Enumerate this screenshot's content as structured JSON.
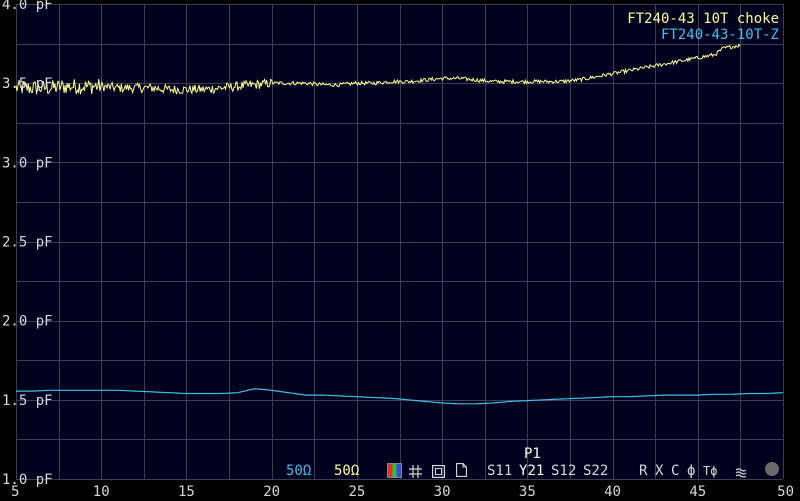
{
  "chart_data": {
    "type": "line",
    "xlim": [
      5,
      50
    ],
    "ylim": [
      1.0,
      4.0
    ],
    "x_ticks": [
      "5",
      "10",
      "15",
      "20",
      "25",
      "30",
      "35",
      "40",
      "45",
      "50"
    ],
    "y_ticks": [
      "1.0 pF",
      "1.5 pF",
      "2.0 pF",
      "2.5 pF",
      "3.0 pF",
      "3.5 pF",
      "4.0 pF"
    ],
    "grid": true,
    "legend_position": "top-right",
    "series": [
      {
        "name": "FT240-43  10T  choke",
        "color": "#ffff90",
        "noisy": true,
        "x": [
          5,
          6,
          7,
          8,
          9,
          10,
          11,
          12,
          13,
          14,
          15,
          16,
          17,
          18,
          19,
          20,
          21,
          22,
          23,
          24,
          25,
          26,
          27,
          28,
          29,
          30,
          31,
          32,
          33,
          34,
          35,
          36,
          37,
          38,
          39,
          40,
          41,
          42,
          43,
          44,
          45,
          45.5,
          46,
          46.5,
          47,
          47.5
        ],
        "y": [
          3.47,
          3.47,
          3.47,
          3.48,
          3.48,
          3.48,
          3.47,
          3.47,
          3.47,
          3.46,
          3.46,
          3.46,
          3.47,
          3.48,
          3.49,
          3.5,
          3.5,
          3.5,
          3.49,
          3.49,
          3.5,
          3.5,
          3.51,
          3.51,
          3.52,
          3.53,
          3.53,
          3.52,
          3.51,
          3.51,
          3.51,
          3.51,
          3.51,
          3.52,
          3.54,
          3.56,
          3.58,
          3.6,
          3.62,
          3.64,
          3.66,
          3.67,
          3.68,
          3.72,
          3.73,
          3.74
        ]
      },
      {
        "name": "FT240-43-10T-Z",
        "color": "#40c0e8",
        "noisy": false,
        "x": [
          5,
          6,
          7,
          8,
          9,
          10,
          11,
          12,
          13,
          14,
          15,
          16,
          17,
          18,
          19,
          20,
          21,
          22,
          23,
          24,
          25,
          26,
          27,
          28,
          29,
          30,
          31,
          32,
          33,
          34,
          35,
          36,
          37,
          38,
          39,
          40,
          41,
          42,
          43,
          44,
          45,
          46,
          47,
          48,
          49,
          50
        ],
        "y": [
          1.555,
          1.555,
          1.56,
          1.56,
          1.56,
          1.56,
          1.56,
          1.555,
          1.55,
          1.545,
          1.54,
          1.54,
          1.54,
          1.545,
          1.57,
          1.56,
          1.545,
          1.53,
          1.53,
          1.525,
          1.52,
          1.515,
          1.51,
          1.5,
          1.49,
          1.48,
          1.475,
          1.475,
          1.48,
          1.49,
          1.495,
          1.5,
          1.505,
          1.51,
          1.515,
          1.52,
          1.52,
          1.525,
          1.53,
          1.53,
          1.53,
          1.535,
          1.535,
          1.54,
          1.54,
          1.545
        ]
      }
    ]
  },
  "toolbar": {
    "ref_impedance_1": "50Ω",
    "ref_impedance_2": "50Ω",
    "colors": {
      "ref1": "#40c0e8",
      "ref2": "#ffff90",
      "active": "#ffffff",
      "inactive": "#d8d8d8"
    },
    "port_label": "P1",
    "params": [
      "S11",
      "Y21",
      "S12",
      "S22"
    ],
    "active_param": "Y21",
    "formats": [
      "R",
      "X",
      "C",
      "ϕ",
      "Tϕ"
    ],
    "icons": [
      "color-palette-icon",
      "grid-icon",
      "layout-icon",
      "document-icon",
      "menu-icon",
      "record-icon"
    ]
  }
}
